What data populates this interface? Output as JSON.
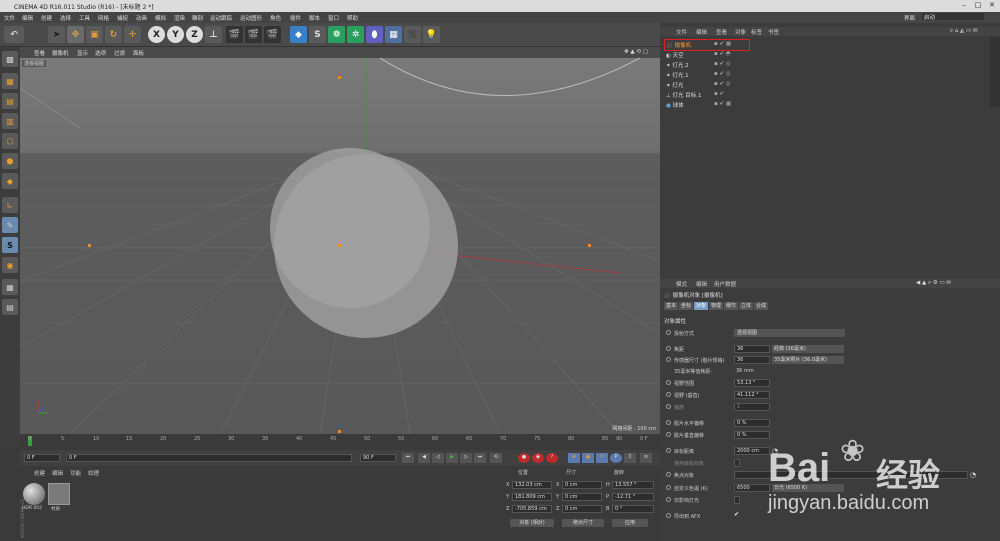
{
  "window": {
    "title": "CINEMA 4D R16.011 Studio (R16) - [未标题 2 *]",
    "min": "–",
    "max": "□",
    "close": "✕"
  },
  "menu": [
    "文件",
    "编辑",
    "创建",
    "选择",
    "工具",
    "网格",
    "捕捉",
    "动画",
    "模拟",
    "渲染",
    "雕刻",
    "运动跟踪",
    "运动图形",
    "角色",
    "插件",
    "脚本",
    "窗口",
    "帮助"
  ],
  "layout": {
    "label": "界面",
    "value": "启动"
  },
  "toolbar": {
    "undo": "↶",
    "x": "X",
    "y": "Y",
    "z": "Z"
  },
  "viewport": {
    "menu": [
      "查看",
      "摄像机",
      "显示",
      "选项",
      "过滤",
      "面板"
    ],
    "name": "透视视图",
    "grid_label": "网格间距 : 100 cm"
  },
  "timeline": {
    "ticks": [
      "0",
      "5",
      "10",
      "15",
      "20",
      "25",
      "30",
      "35",
      "40",
      "45",
      "50",
      "55",
      "60",
      "65",
      "70",
      "75",
      "80",
      "85",
      "90"
    ],
    "frame": "0 F"
  },
  "playback": {
    "start": "0 F",
    "current": "0 F",
    "end": "90 F",
    "end2": "90 F"
  },
  "material": {
    "menu": [
      "创建",
      "编辑",
      "功能",
      "纹理"
    ],
    "items": [
      "HDR 002",
      "材质"
    ],
    "brand": "MAXON CINEMA 4D"
  },
  "coords": {
    "headers": [
      "位置",
      "尺寸",
      "旋转"
    ],
    "rows": [
      {
        "axis": "X",
        "pos": "132.03 cm",
        "size_axis": "X",
        "size": "0 cm",
        "rot_axis": "H",
        "rot": "13.557 °"
      },
      {
        "axis": "Y",
        "pos": "181.809 cm",
        "size_axis": "Y",
        "size": "0 cm",
        "rot_axis": "P",
        "rot": "-12.71 °"
      },
      {
        "axis": "Z",
        "pos": "-705.859 cm",
        "size_axis": "Z",
        "size": "0 cm",
        "rot_axis": "B",
        "rot": "0 °"
      }
    ],
    "mode": "对象 (相对)",
    "size_mode": "绝对尺寸",
    "apply": "应用"
  },
  "objects": {
    "menu": [
      "文件",
      "编辑",
      "查看",
      "对象",
      "标签",
      "书签"
    ],
    "items": [
      {
        "name": "摄像机",
        "selected": true,
        "color": "#e88a2a"
      },
      {
        "name": "天空",
        "selected": false,
        "color": "#ddd"
      },
      {
        "name": "灯光.2",
        "selected": false,
        "color": "#ddd"
      },
      {
        "name": "灯光.1",
        "selected": false,
        "color": "#ddd"
      },
      {
        "name": "灯光",
        "selected": false,
        "color": "#ddd"
      },
      {
        "name": "灯光 目标.1",
        "selected": false,
        "color": "#ddd"
      },
      {
        "name": "球体",
        "selected": false,
        "color": "#ddd"
      }
    ]
  },
  "attributes": {
    "menu": [
      "模式",
      "编辑",
      "用户数据"
    ],
    "object_title": "摄像机对象 [摄像机]",
    "tabs": [
      "基本",
      "坐标",
      "对象",
      "物理",
      "细节",
      "立体",
      "合成"
    ],
    "active_tab": "对象",
    "section": "对象属性",
    "fields": [
      {
        "label": "投射方式",
        "value": "透视视图",
        "type": "select"
      },
      {
        "label": "焦距",
        "value": "36",
        "extra": "经典 (36毫米)",
        "type": "num"
      },
      {
        "label": "传感器尺寸 (胶片规格)",
        "value": "36",
        "extra": "35毫米照片 (36.0毫米)",
        "type": "num"
      },
      {
        "label": "35毫米等值焦距:",
        "value": "36 mm",
        "type": "text"
      },
      {
        "label": "视野范围",
        "value": "53.13 °",
        "type": "num"
      },
      {
        "label": "视野 (垂直)",
        "value": "41.112 °",
        "type": "num"
      },
      {
        "label": "缩放",
        "value": "1",
        "type": "num"
      },
      {
        "label": "胶片水平偏移",
        "value": "0 %",
        "type": "num"
      },
      {
        "label": "胶片垂直偏移",
        "value": "0 %",
        "type": "num"
      },
      {
        "label": "目标距离",
        "value": "2000 cm",
        "type": "num"
      },
      {
        "label": "使用目标对象",
        "value": "",
        "type": "check"
      },
      {
        "label": "焦点对象",
        "value": "",
        "type": "link"
      },
      {
        "label": "自定义色温 (K)",
        "value": "6500",
        "extra": "日光 (6500 K)",
        "type": "num"
      },
      {
        "label": "仅影响灯光",
        "value": "",
        "type": "check"
      },
      {
        "label": "导出到 AFX",
        "value": "✔",
        "type": "check"
      }
    ]
  },
  "watermark": {
    "brand": "Bai",
    "brand2": "经验",
    "url": "jingyan.baidu.com"
  },
  "colors": {
    "accent_orange": "#e88a2a",
    "selected_text": "#ff9a2a",
    "highlight_red": "#e02020",
    "axis_x": "#d03030",
    "axis_y": "#30c030",
    "axis_z": "#3060e0"
  }
}
